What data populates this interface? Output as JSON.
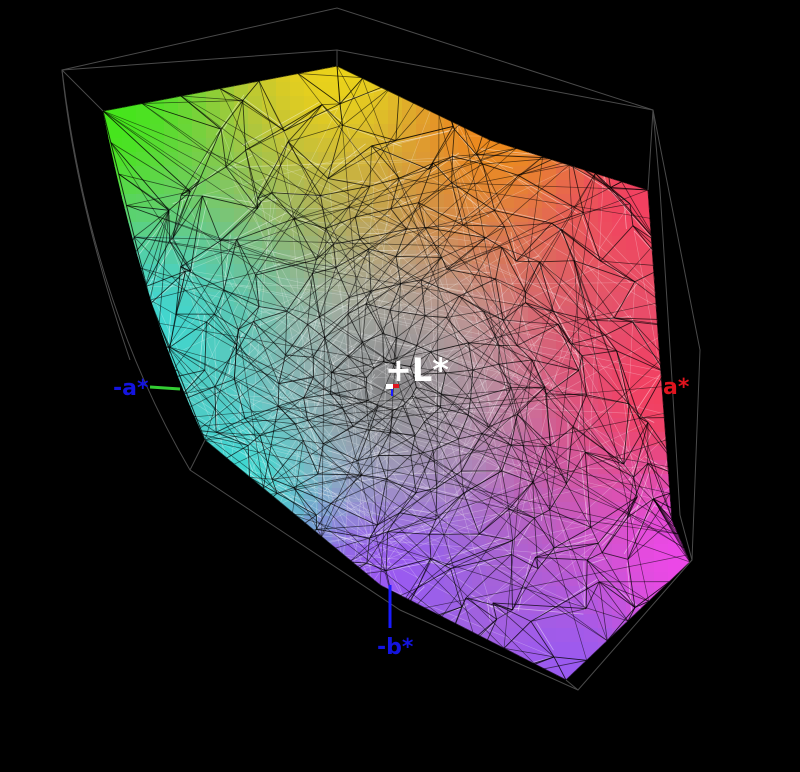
{
  "scene": {
    "background": "#000000",
    "gamut_colors": {
      "white": "#e6e6e6",
      "green": "#44e61a",
      "yellow": "#ead21a",
      "orange": "#ee8a1a",
      "red": "#f24060",
      "magenta": "#ec48e8",
      "violet": "#9a5af0",
      "cyan": "#40d6d0",
      "mesh_dark": "#000000",
      "mesh_light": "#ffffff"
    },
    "axes": {
      "l_plus": {
        "label": "+L*",
        "color": "#ffffff"
      },
      "a_plus": {
        "label": "a*",
        "color": "#e0141e"
      },
      "a_minus": {
        "label": "-a*",
        "color": "#1414e0"
      },
      "b_minus": {
        "label": "-b*",
        "color": "#1414e0"
      },
      "a_minus_line_color": "#33cc33",
      "b_minus_line_color": "#1a1aff"
    }
  }
}
